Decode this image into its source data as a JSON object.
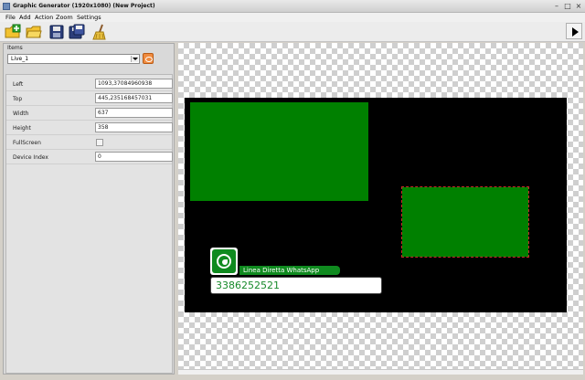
{
  "window": {
    "title": "Graphic Generator (1920x1080) (New Project)"
  },
  "menu": [
    "File",
    "Add",
    "Action",
    "Zoom",
    "Settings"
  ],
  "left_panel": {
    "items_label": "Items",
    "selected_item": "Live_1",
    "properties": [
      {
        "label": "Left",
        "value": "1093,37084960938"
      },
      {
        "label": "Top",
        "value": "445,235168457031"
      },
      {
        "label": "Width",
        "value": "637"
      },
      {
        "label": "Height",
        "value": "358"
      },
      {
        "label": "FullScreen",
        "value": ""
      },
      {
        "label": "Device Index",
        "value": "0"
      }
    ]
  },
  "overlay": {
    "label": "Linea Diretta WhatsApp",
    "number": "3386252521"
  },
  "colors": {
    "stage": "#000000",
    "green": "#008000",
    "whatsapp_green": "#0f8a1f",
    "selection": "#c62828"
  }
}
